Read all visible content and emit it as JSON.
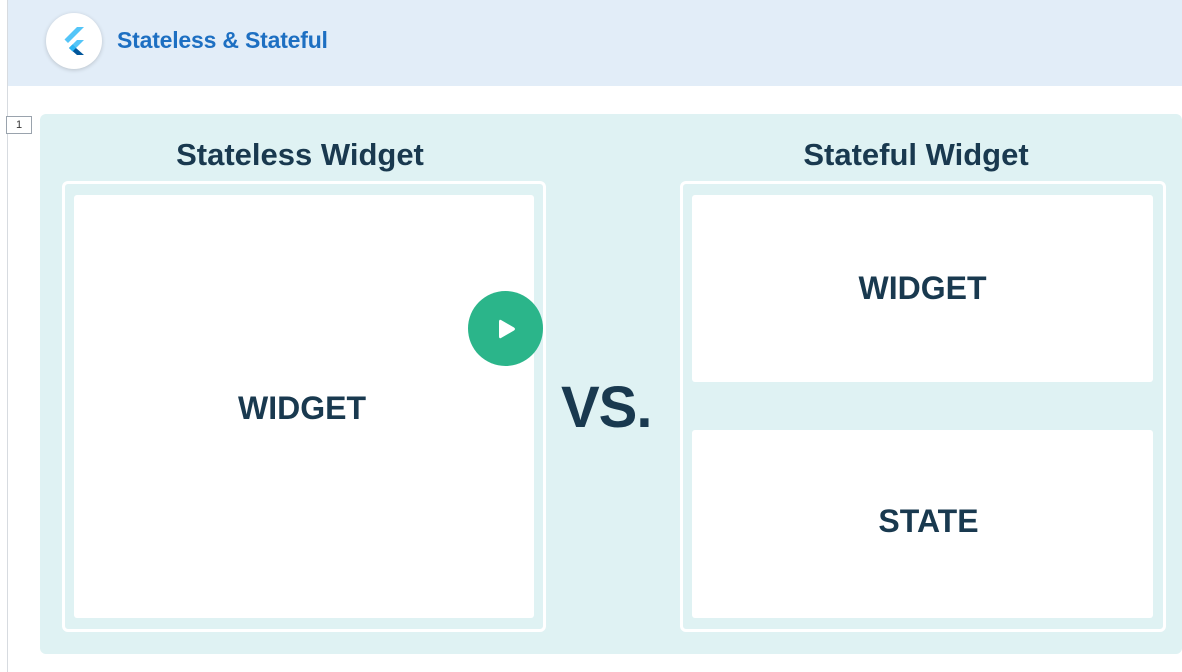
{
  "header": {
    "title": "Stateless & Stateful",
    "logo_icon": "flutter-logo-icon"
  },
  "page_indicator": "1",
  "slide": {
    "left_column": {
      "title": "Stateless Widget",
      "panel_label": "WIDGET"
    },
    "separator": "VS.",
    "right_column": {
      "title": "Stateful Widget",
      "top_panel_label": "WIDGET",
      "bottom_panel_label": "STATE"
    }
  },
  "player": {
    "play_icon": "play-icon",
    "accent_color": "#2bb58a"
  },
  "colors": {
    "header_bg": "#e2edf8",
    "title_blue": "#1d6fc2",
    "slide_bg": "#dff2f3",
    "text_dark": "#19394f"
  }
}
